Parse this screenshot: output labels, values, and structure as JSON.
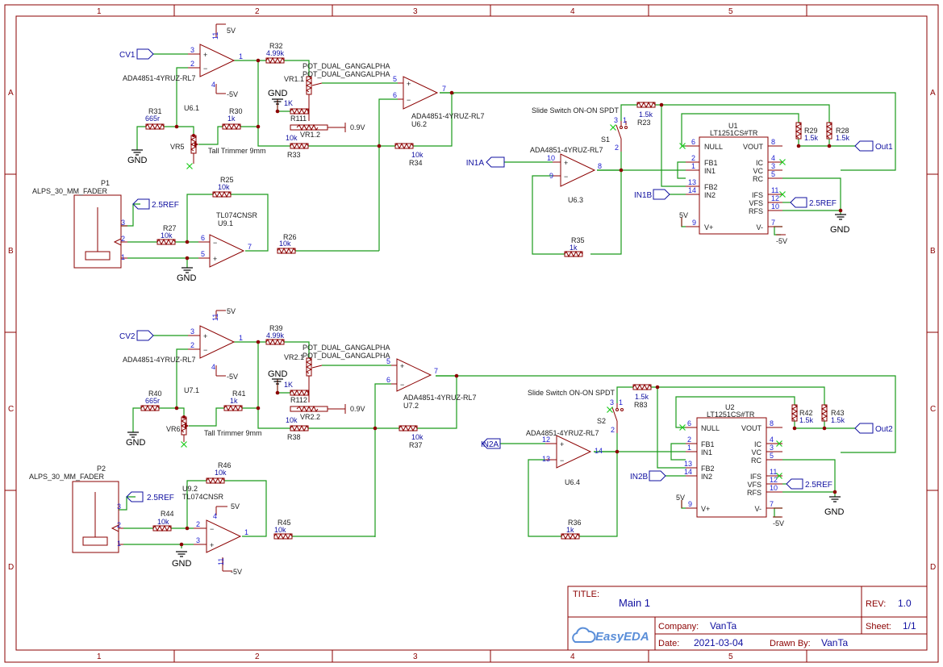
{
  "sheet": {
    "col_labels": [
      "1",
      "2",
      "3",
      "4",
      "5"
    ],
    "row_labels": [
      "A",
      "B",
      "C",
      "D"
    ]
  },
  "ch1": {
    "cv": "CV1",
    "op_top": "ADA4851-4YRUZ-RL7",
    "op_top_ref": "U6.1",
    "pin3": "3",
    "pin2": "2",
    "pin1": "1",
    "pin11": "11",
    "pin4": "4",
    "vpos": "5V",
    "vneg": "-5V",
    "r32": "R32",
    "r32v": "4.99k",
    "pot1": "POT_DUAL_GANGALPHA",
    "pot2": "POT_DUAL_GANGALPHA",
    "vr1": "VR1.1",
    "vr12": "VR1.2",
    "r111": "R111",
    "r111v": "1K",
    "gnd": "GND",
    "v09": "0.9V",
    "r31": "R31",
    "r31v": "665r",
    "r30": "R30",
    "r30v": "1k",
    "r33": "R33",
    "r33v": "10k",
    "vr5": "VR5",
    "trim": "Tall Trimmer 9mm",
    "op2": "ADA4851-4YRUZ-RL7",
    "op2_ref": "U6.2",
    "p5": "5",
    "p6": "6",
    "p7": "7",
    "r34": "R34",
    "r34v": "10k",
    "fader_ref": "P1",
    "fader": "ALPS_30_MM_FADER",
    "ref25": "2.5REF",
    "r25": "R25",
    "r25v": "10k",
    "r27": "R27",
    "r27v": "10k",
    "tl": "TL074CNSR",
    "tl_ref": "U9.1",
    "r26": "R26",
    "r26v": "10k",
    "fp3": "3",
    "fp2": "2",
    "fp1": "1",
    "tp6": "6",
    "tp5": "5",
    "tp7": "7",
    "slide": "Slide Switch ON-ON SPDT",
    "s": "S1",
    "r23": "R23",
    "r23v": "1.5k",
    "in_a": "IN1A",
    "in_b": "IN1B",
    "op3": "ADA4851-4YRUZ-RL7",
    "op3_ref": "U6.3",
    "p10": "10",
    "p9": "9",
    "p8": "8",
    "r35": "R35",
    "r35v": "1k",
    "u": "U1",
    "upart": "LT1251CS#TR",
    "null": "NULL",
    "vout": "VOUT",
    "fb1": "FB1",
    "in1": "IN1",
    "fb2": "FB2",
    "in2": "IN2",
    "ic": "IC",
    "vc": "VC",
    "rc": "RC",
    "ifs": "IFS",
    "vfs": "VFS",
    "rfs": "RFS",
    "vp": "V+",
    "vm": "V-",
    "r29": "R29",
    "r29v": "1.5k",
    "r28": "R28",
    "r28v": "1.5k",
    "out": "Out1",
    "up6": "6",
    "up2": "2",
    "up1": "1",
    "up13": "13",
    "up14": "14",
    "up9": "9",
    "up8": "8",
    "up4": "4",
    "up3": "3",
    "up5": "5",
    "up11": "11",
    "up12": "12",
    "up10": "10",
    "up7": "7"
  },
  "ch2": {
    "cv": "CV2",
    "op_top": "ADA4851-4YRUZ-RL7",
    "op_top_ref": "U7.1",
    "pin3": "3",
    "pin2": "2",
    "pin1": "1",
    "pin11": "11",
    "pin4": "4",
    "vpos": "5V",
    "vneg": "-5V",
    "r39": "R39",
    "r39v": "4.99k",
    "pot1": "POT_DUAL_GANGALPHA",
    "pot2": "POT_DUAL_GANGALPHA",
    "vr1": "VR2.1",
    "vr12": "VR2.2",
    "r112": "R112",
    "r112v": "1K",
    "gnd": "GND",
    "v09": "0.9V",
    "r40": "R40",
    "r40v": "665r",
    "r41": "R41",
    "r41v": "1k",
    "r38": "R38",
    "r38v": "10k",
    "vr6": "VR6",
    "trim": "Tall Trimmer 9mm",
    "op2": "ADA4851-4YRUZ-RL7",
    "op2_ref": "U7.2",
    "p5": "5",
    "p6": "6",
    "p7": "7",
    "r37": "R37",
    "r37v": "10k",
    "fader_ref": "P2",
    "fader": "ALPS_30_MM_FADER",
    "ref25": "2.5REF",
    "r46": "R46",
    "r46v": "10k",
    "r44": "R44",
    "r44v": "10k",
    "tl": "TL074CNSR",
    "tl_ref": "U9.2",
    "r45": "R45",
    "r45v": "10k",
    "fp3": "3",
    "fp2": "2",
    "fp1": "1",
    "tp2": "2",
    "tp3": "3",
    "tp1": "1",
    "tp4": "4",
    "tp11": "11",
    "slide": "Slide Switch ON-ON SPDT",
    "s": "S2",
    "r83": "R83",
    "r83v": "1.5k",
    "in_a": "IN2A",
    "in_b": "IN2B",
    "op3": "ADA4851-4YRUZ-RL7",
    "op3_ref": "U6.4",
    "p12": "12",
    "p13": "13",
    "p14": "14",
    "r36": "R36",
    "r36v": "1k",
    "u": "U2",
    "upart": "LT1251CS#TR",
    "null": "NULL",
    "vout": "VOUT",
    "fb1": "FB1",
    "in1": "IN1",
    "fb2": "FB2",
    "in2": "IN2",
    "ic": "IC",
    "vc": "VC",
    "rc": "RC",
    "ifs": "IFS",
    "vfs": "VFS",
    "rfs": "RFS",
    "vp": "V+",
    "vm": "V-",
    "r42": "R42",
    "r42v": "1.5k",
    "r43": "R43",
    "r43v": "1.5k",
    "out": "Out2",
    "up6": "6",
    "up2": "2",
    "up1": "1",
    "up13": "13",
    "up14": "14",
    "up9": "9",
    "up8": "8",
    "up4": "4",
    "up3": "3",
    "up5": "5",
    "up11": "11",
    "up12": "12",
    "up10": "10",
    "up7": "7"
  },
  "title_block": {
    "title_label": "TITLE:",
    "title": "Main 1",
    "rev_label": "REV:",
    "rev": "1.0",
    "company_label": "Company:",
    "company": "VanTa",
    "sheet_label": "Sheet:",
    "sheet": "1/1",
    "date_label": "Date:",
    "date": "2021-03-04",
    "drawn_label": "Drawn By:",
    "drawn": "VanTa",
    "logo": "EasyEDA"
  }
}
